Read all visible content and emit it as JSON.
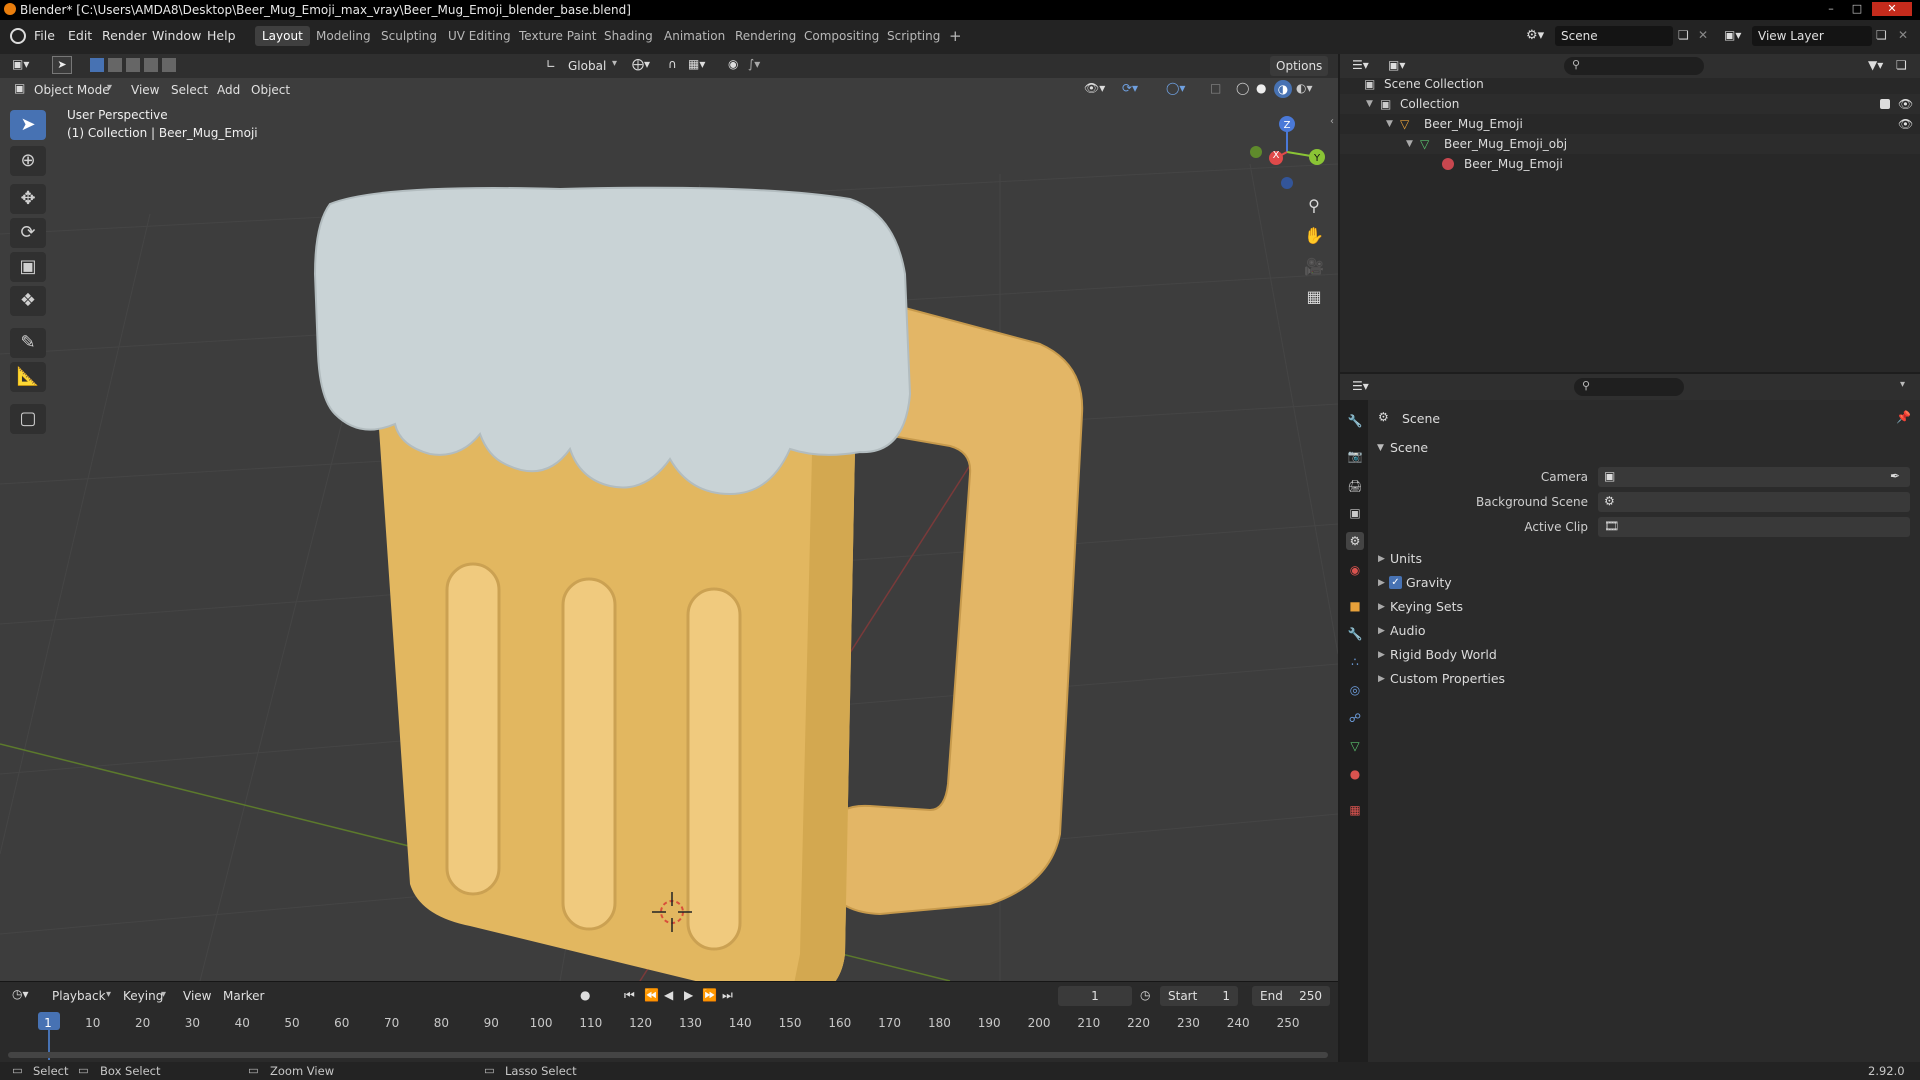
{
  "window": {
    "title": "Blender* [C:\\Users\\AMDA8\\Desktop\\Beer_Mug_Emoji_max_vray\\Beer_Mug_Emoji_blender_base.blend]"
  },
  "menus": [
    "File",
    "Edit",
    "Render",
    "Window",
    "Help"
  ],
  "workspaces": [
    "Layout",
    "Modeling",
    "Sculpting",
    "UV Editing",
    "Texture Paint",
    "Shading",
    "Animation",
    "Rendering",
    "Compositing",
    "Scripting"
  ],
  "active_workspace": "Layout",
  "scene_name": "Scene",
  "view_layer": "View Layer",
  "viewport": {
    "mode": "Object Mode",
    "header_menus": [
      "View",
      "Select",
      "Add",
      "Object"
    ],
    "transform_orientation": "Global",
    "options_label": "Options",
    "info_line1": "User Perspective",
    "info_line2": "(1) Collection | Beer_Mug_Emoji",
    "gizmo": {
      "x": "X",
      "y": "Y",
      "z": "Z"
    }
  },
  "colors": {
    "accent": "#4772b3",
    "foam": "#c9d3d6",
    "mug": "#e2b760",
    "grid_x": "#7a3a3a",
    "grid_y": "#5c7a2c"
  },
  "outliner": {
    "rows": [
      {
        "label": "Scene Collection",
        "icon": "scene-collection-icon"
      },
      {
        "label": "Collection",
        "icon": "collection-icon"
      },
      {
        "label": "Beer_Mug_Emoji",
        "icon": "empty-object-icon"
      },
      {
        "label": "Beer_Mug_Emoji_obj",
        "icon": "mesh-object-icon"
      },
      {
        "label": "Beer_Mug_Emoji",
        "icon": "material-icon"
      }
    ]
  },
  "properties": {
    "context": "Scene",
    "panel": "Scene",
    "fields": [
      {
        "label": "Camera"
      },
      {
        "label": "Background Scene"
      },
      {
        "label": "Active Clip"
      }
    ],
    "sections": [
      "Units",
      "Gravity",
      "Keying Sets",
      "Audio",
      "Rigid Body World",
      "Custom Properties"
    ],
    "gravity_enabled": true
  },
  "timeline": {
    "menus": [
      "Playback",
      "Keying",
      "View",
      "Marker"
    ],
    "current_frame": "1",
    "start_label": "Start",
    "start": "1",
    "end_label": "End",
    "end": "250",
    "ticks": [
      "1",
      "10",
      "20",
      "30",
      "40",
      "50",
      "60",
      "70",
      "80",
      "90",
      "100",
      "110",
      "120",
      "130",
      "140",
      "150",
      "160",
      "170",
      "180",
      "190",
      "200",
      "210",
      "220",
      "230",
      "240",
      "250"
    ]
  },
  "statusbar": {
    "select": "Select",
    "box_select": "Box Select",
    "zoom_view": "Zoom View",
    "lasso_select": "Lasso Select",
    "version": "2.92.0"
  }
}
